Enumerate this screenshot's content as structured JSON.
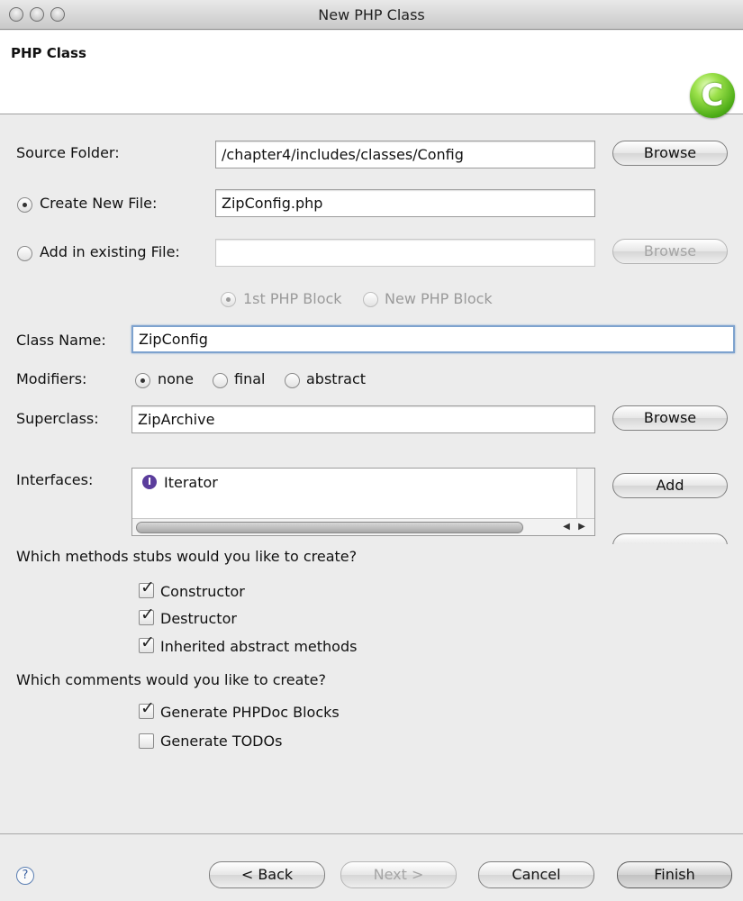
{
  "window": {
    "title": "New PHP Class"
  },
  "header": {
    "title": "PHP Class",
    "logo_letter": "C"
  },
  "source_folder": {
    "label": "Source Folder:",
    "value": "/chapter4/includes/classes/Config",
    "browse_label": "Browse"
  },
  "create_new_file": {
    "label": "Create New File:",
    "selected": true,
    "value": "ZipConfig.php"
  },
  "add_existing_file": {
    "label": "Add in existing File:",
    "selected": false,
    "value": "",
    "browse_label": "Browse",
    "enabled": false
  },
  "php_block": {
    "options": [
      "1st PHP Block",
      "New PHP Block"
    ],
    "selected": "1st PHP Block",
    "enabled": false
  },
  "class_name": {
    "label": "Class Name:",
    "value": "ZipConfig"
  },
  "modifiers": {
    "label": "Modifiers:",
    "options": [
      "none",
      "final",
      "abstract"
    ],
    "selected": "none"
  },
  "superclass": {
    "label": "Superclass:",
    "value": "ZipArchive",
    "browse_label": "Browse"
  },
  "interfaces": {
    "label": "Interfaces:",
    "items": [
      "Iterator"
    ],
    "add_label": "Add"
  },
  "method_stubs": {
    "question": "Which methods stubs would you like to create?",
    "options": [
      {
        "label": "Constructor",
        "checked": true
      },
      {
        "label": "Destructor",
        "checked": true
      },
      {
        "label": "Inherited abstract methods",
        "checked": true
      }
    ]
  },
  "comments": {
    "question": "Which comments would you like to create?",
    "options": [
      {
        "label": "Generate PHPDoc Blocks",
        "checked": true
      },
      {
        "label": "Generate TODOs",
        "checked": false
      }
    ]
  },
  "footer": {
    "help_glyph": "?",
    "back_label": "< Back",
    "next_label": "Next >",
    "cancel_label": "Cancel",
    "finish_label": "Finish"
  },
  "glyphs": {
    "check": "✓",
    "scroll_left": "◀",
    "scroll_right": "▶",
    "interface_icon": "I"
  }
}
